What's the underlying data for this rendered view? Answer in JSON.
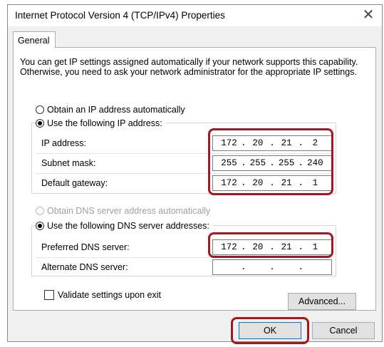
{
  "window": {
    "title": "Internet Protocol Version 4 (TCP/IPv4) Properties",
    "close_glyph": "✕"
  },
  "tabs": [
    {
      "label": "General",
      "selected": true
    }
  ],
  "description": "You can get IP settings assigned automatically if your network supports this capability. Otherwise, you need to ask your network administrator for the appropriate IP settings.",
  "ip_section": {
    "auto_option": {
      "label": "Obtain an IP address automatically",
      "selected": false
    },
    "manual_option": {
      "label": "Use the following IP address:",
      "selected": true
    },
    "fields": [
      {
        "label": "IP address:",
        "octets": [
          "172",
          "20",
          "21",
          "2"
        ]
      },
      {
        "label": "Subnet mask:",
        "octets": [
          "255",
          "255",
          "255",
          "240"
        ]
      },
      {
        "label": "Default gateway:",
        "octets": [
          "172",
          "20",
          "21",
          "1"
        ]
      }
    ]
  },
  "dns_section": {
    "auto_option": {
      "label": "Obtain DNS server address automatically",
      "selected": false,
      "enabled": false
    },
    "manual_option": {
      "label": "Use the following DNS server addresses:",
      "selected": true
    },
    "fields": [
      {
        "label": "Preferred DNS server:",
        "octets": [
          "172",
          "20",
          "21",
          "1"
        ]
      },
      {
        "label": "Alternate DNS server:",
        "octets": [
          "",
          "",
          "",
          ""
        ]
      }
    ]
  },
  "validate": {
    "label": "Validate settings upon exit",
    "checked": false
  },
  "buttons": {
    "advanced": "Advanced...",
    "ok": "OK",
    "cancel": "Cancel"
  },
  "colors": {
    "highlight": "#a3171f",
    "dialog_bg": "#f0f0f0",
    "default_button_border": "#0078d7"
  }
}
